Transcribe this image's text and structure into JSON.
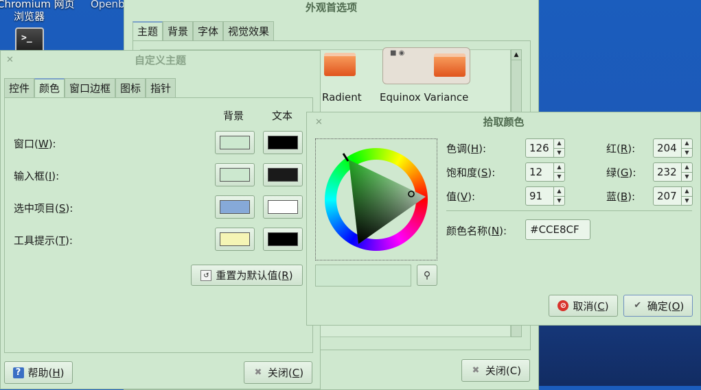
{
  "desktop": {
    "icon1_label_line1": "Chromium 网页",
    "icon1_label_line2": "浏览器",
    "icon2_label": "Openbox 配置",
    "terminal_glyph": ">_",
    "icon_plus": "+ ▮"
  },
  "appearance_window": {
    "title": "外观首选项",
    "tabs": [
      "主题",
      "背景",
      "字体",
      "视觉效果"
    ],
    "active_tab": "主题",
    "themes": [
      "Radient",
      "Equinox Variance"
    ],
    "close_label": "关闭(C)"
  },
  "custom_theme_window": {
    "title": "自定义主题",
    "tabs": [
      "控件",
      "颜色",
      "窗口边框",
      "图标",
      "指针"
    ],
    "active_tab": "颜色",
    "col_bg": "背景",
    "col_text": "文本",
    "rows": [
      {
        "label": "窗口(",
        "key": "W",
        "suffix": "):",
        "bg": "#cce8cf",
        "text": "#000000"
      },
      {
        "label": "输入框(",
        "key": "I",
        "suffix": "):",
        "bg": "#cce8cf",
        "text": "#1a1a1a"
      },
      {
        "label": "选中项目(",
        "key": "S",
        "suffix": "):",
        "bg": "#86a9d8",
        "text": "#ffffff"
      },
      {
        "label": "工具提示(",
        "key": "T",
        "suffix": "):",
        "bg": "#f5f5b5",
        "text": "#000000"
      }
    ],
    "reset_label": "重置为默认值(",
    "reset_key": "R",
    "help_label": "帮助(",
    "help_key": "H",
    "close_label": "关闭(",
    "close_key": "C"
  },
  "color_picker": {
    "title": "拾取颜色",
    "hue_label": "色调(",
    "hue_key": "H",
    "hue": "126",
    "sat_label": "饱和度(",
    "sat_key": "S",
    "sat": "12",
    "val_label": "值(",
    "val_key": "V",
    "val": "91",
    "red_label": "红(",
    "red_key": "R",
    "red": "204",
    "green_label": "绿(",
    "green_key": "G",
    "green": "232",
    "blue_label": "蓝(",
    "blue_key": "B",
    "blue": "207",
    "name_label": "颜色名称(",
    "name_key": "N",
    "color_name": "#CCE8CF",
    "cancel_label": "取消(",
    "cancel_key": "C",
    "ok_label": "确定(",
    "ok_key": "O",
    "current_color": "#cce8cf"
  }
}
